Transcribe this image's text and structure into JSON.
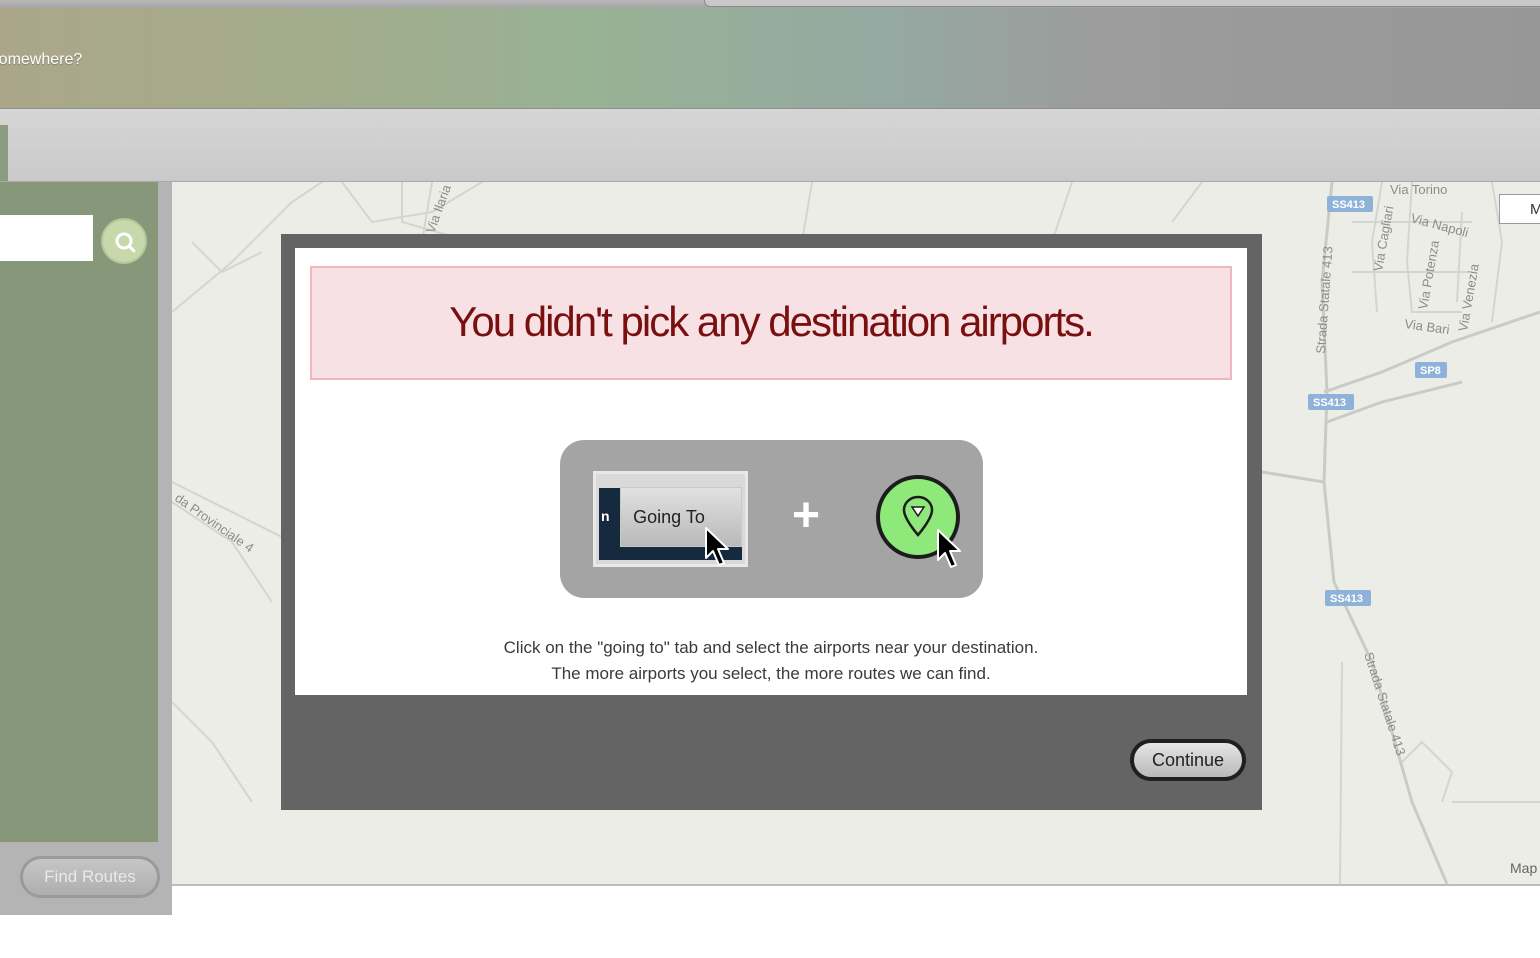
{
  "header": {
    "tagline": "Somewhere?"
  },
  "sidebar": {
    "search_value": "",
    "search_icon": "search-icon",
    "find_routes_label": "Find Routes"
  },
  "map": {
    "roads": [
      "Via Torino",
      "Via Napoli",
      "Via Cagliari",
      "Via Potenza",
      "Via Venezia",
      "Via Bari",
      "Strada Statale 413",
      "Strada Statale 413",
      "da Provinciale 4",
      "Via Ilaria"
    ],
    "shields": [
      "SS413",
      "SP8",
      "SS413",
      "SS413"
    ],
    "type_button": "M",
    "credit": "Map"
  },
  "dialog": {
    "title": "You didn't pick any destination airports.",
    "illustration": {
      "tab_label": "Going To",
      "tab_fragment": "n",
      "plus": "+",
      "pin_icon": "map-pin-icon"
    },
    "message_line1": "Click on the \"going to\" tab and select the airports near your destination.",
    "message_line2": "The more airports you select, the more routes we can find.",
    "continue_label": "Continue"
  },
  "colors": {
    "alert_background": "#f8e1e4",
    "alert_text": "#7a0f10",
    "sidebar": "#879779",
    "pin_green": "#8ee87a",
    "overlay": "#646464"
  }
}
